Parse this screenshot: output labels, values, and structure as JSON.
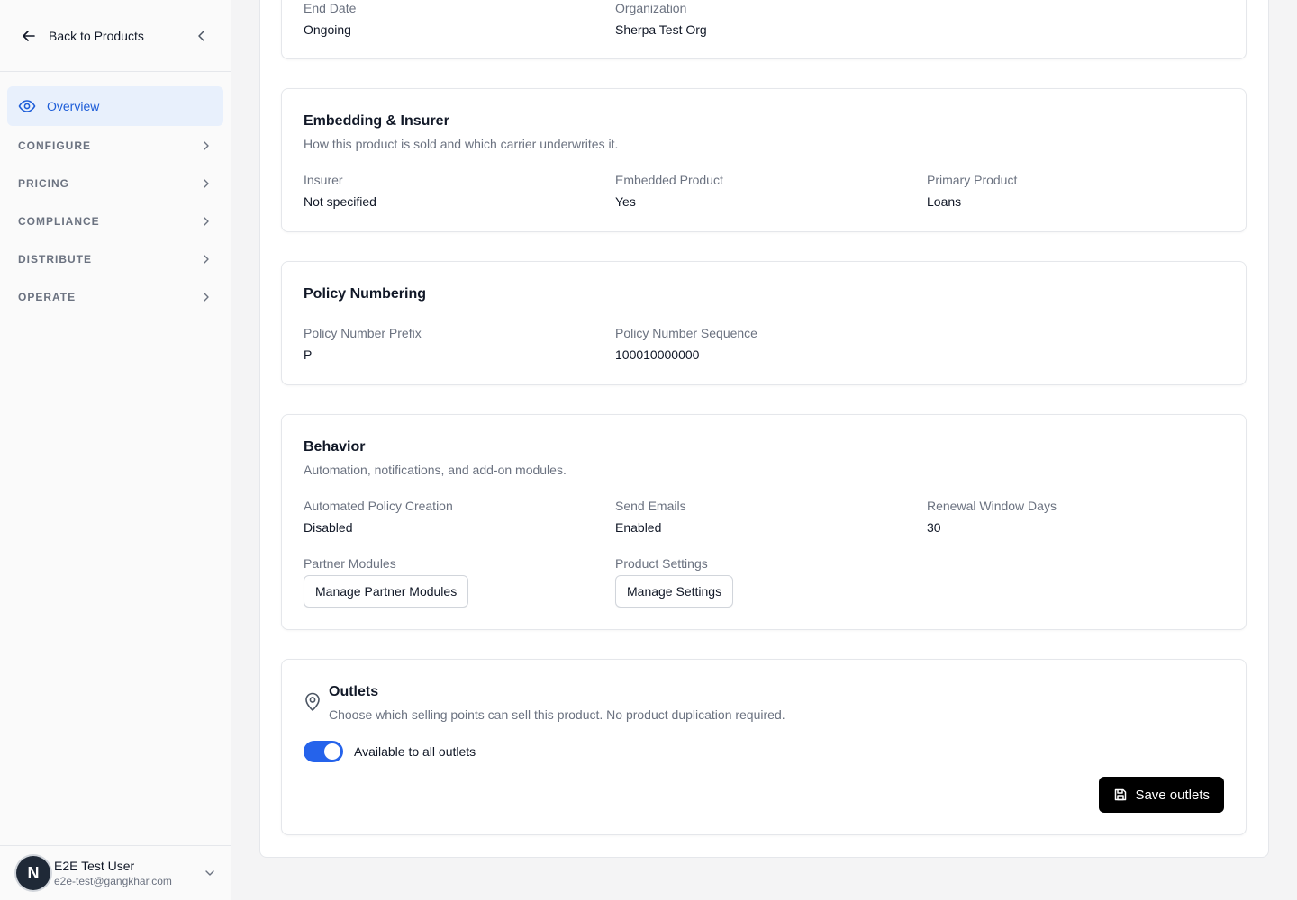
{
  "sidebar": {
    "back_label": "Back to Products",
    "active_item": "Overview",
    "sections": [
      "CONFIGURE",
      "PRICING",
      "COMPLIANCE",
      "DISTRIBUTE",
      "OPERATE"
    ],
    "user": {
      "initial": "N",
      "name": "E2E Test User",
      "email": "e2e-test@gangkhar.com"
    }
  },
  "general": {
    "end_date_label": "End Date",
    "end_date_value": "Ongoing",
    "organization_label": "Organization",
    "organization_value": "Sherpa Test Org"
  },
  "embedding": {
    "title": "Embedding & Insurer",
    "subtitle": "How this product is sold and which carrier underwrites it.",
    "insurer_label": "Insurer",
    "insurer_value": "Not specified",
    "embedded_label": "Embedded Product",
    "embedded_value": "Yes",
    "primary_label": "Primary Product",
    "primary_value": "Loans"
  },
  "policy_numbering": {
    "title": "Policy Numbering",
    "prefix_label": "Policy Number Prefix",
    "prefix_value": "P",
    "sequence_label": "Policy Number Sequence",
    "sequence_value": "100010000000"
  },
  "behavior": {
    "title": "Behavior",
    "subtitle": "Automation, notifications, and add-on modules.",
    "auto_label": "Automated Policy Creation",
    "auto_value": "Disabled",
    "emails_label": "Send Emails",
    "emails_value": "Enabled",
    "renewal_label": "Renewal Window Days",
    "renewal_value": "30",
    "partner_label": "Partner Modules",
    "partner_button": "Manage Partner Modules",
    "settings_label": "Product Settings",
    "settings_button": "Manage Settings"
  },
  "outlets": {
    "title": "Outlets",
    "subtitle": "Choose which selling points can sell this product. No product duplication required.",
    "toggle_label": "Available to all outlets",
    "toggle_on": true,
    "save_button": "Save outlets"
  },
  "colors": {
    "accent": "#2563eb",
    "active_bg": "#e8f0fc",
    "primary_button": "#000000"
  }
}
